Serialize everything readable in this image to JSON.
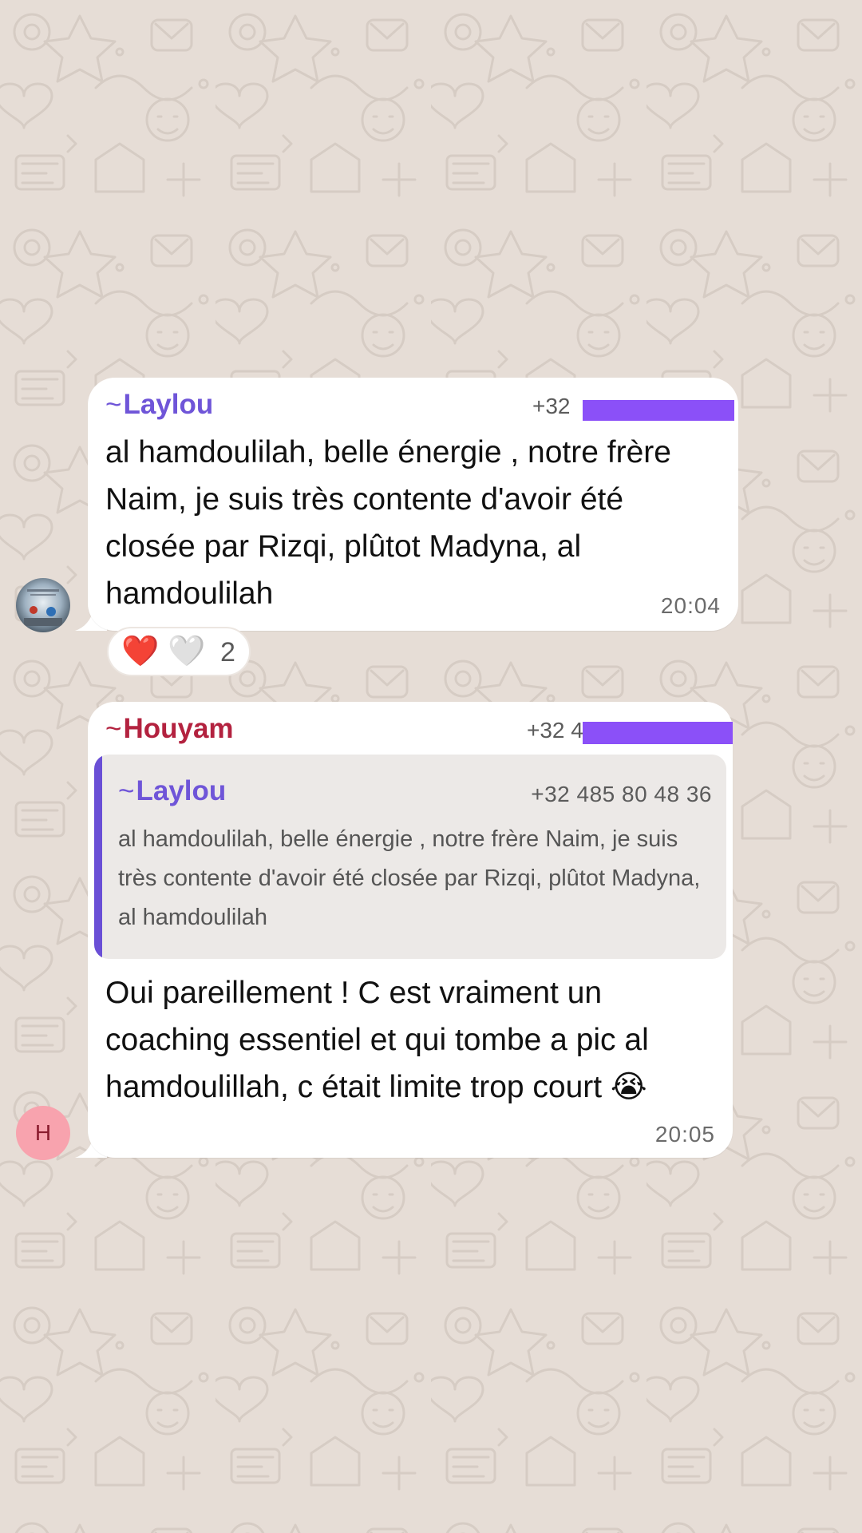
{
  "colors": {
    "wallpaper": "#e6ddd6",
    "bubble": "#ffffff",
    "laylou_name": "#6f55d8",
    "houyam_name": "#b3223f",
    "redaction": "#8b50f8",
    "houyam_avatar": "#f8a3ae"
  },
  "messages": [
    {
      "sender_prefix": "~",
      "sender_name": "Laylou",
      "sender_phone": "+32",
      "text": "al hamdoulilah, belle énergie , notre frère Naim, je suis très contente d'avoir été closée par Rizqi, plûtot Madyna, al hamdoulilah",
      "time": "20:04",
      "avatar_icon": "profile-photo-icon",
      "reactions": {
        "emojis": [
          "❤️",
          "🤍"
        ],
        "count": "2"
      }
    },
    {
      "sender_prefix": "~",
      "sender_name": "Houyam",
      "sender_phone": "+32 4",
      "avatar_initial": "H",
      "quote": {
        "sender_prefix": "~",
        "sender_name": "Laylou",
        "sender_phone": "+32 485 80 48 36",
        "text": "al hamdoulilah, belle énergie , notre frère Naim, je suis très contente d'avoir été closée par Rizqi, plûtot Madyna, al hamdoulilah"
      },
      "text": "Oui pareillement ! C est vraiment un coaching essentiel et qui tombe a pic al hamdoulillah, c était limite trop court 😭",
      "time": "20:05"
    }
  ]
}
